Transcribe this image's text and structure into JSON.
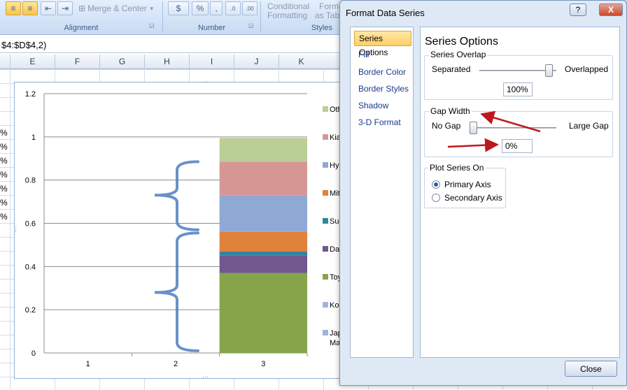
{
  "ribbon": {
    "merge_center": "Merge & Center",
    "currency": "$",
    "percent": "%",
    "comma": ",",
    "inc_decimal": ".0",
    "dec_decimal": ".00",
    "cond_format_1": "Conditional",
    "cond_format_2": "Formatting",
    "format_table_1": "Forma",
    "format_table_2": "as Tabl",
    "groups": {
      "alignment": "Alignment",
      "number": "Number",
      "styles": "Styles"
    }
  },
  "formula": "$4:$D$4,2)",
  "columns": [
    "E",
    "F",
    "G",
    "H",
    "I",
    "J",
    "K"
  ],
  "row_values": [
    "%",
    "%",
    "%",
    "%",
    "%",
    "%",
    "%"
  ],
  "chart_data": {
    "type": "bar",
    "stacked": true,
    "categories": [
      "1",
      "2",
      "3"
    ],
    "series": [
      {
        "name": "Toy",
        "values": [
          0,
          0,
          0.37
        ],
        "color": "#86a44a"
      },
      {
        "name": "Dai",
        "values": [
          0,
          0,
          0.08
        ],
        "color": "#71588f"
      },
      {
        "name": "Suz",
        "values": [
          0,
          0,
          0.02
        ],
        "color": "#31859c"
      },
      {
        "name": "Mit",
        "values": [
          0,
          0,
          0.09
        ],
        "color": "#e0823a"
      },
      {
        "name": "Hy",
        "values": [
          0,
          0,
          0.17
        ],
        "color": "#8fa9d5"
      },
      {
        "name": "Kia",
        "values": [
          0,
          0,
          0.155
        ],
        "color": "#d69794"
      },
      {
        "name": "Oth",
        "values": [
          0,
          0,
          0.11
        ],
        "color": "#b9cf96"
      }
    ],
    "legend_extra": [
      {
        "name": "Kor",
        "color": "#9fb5dc"
      },
      {
        "name": "Jap",
        "name2": "Ma",
        "color": "#9fb5dc"
      }
    ],
    "y_ticks": [
      "0",
      "0.2",
      "0.4",
      "0.6",
      "0.8",
      "1",
      "1.2"
    ],
    "ylim": [
      0,
      1.2
    ],
    "grid": true,
    "legend_position": "right"
  },
  "dialog": {
    "title": "Format Data Series",
    "help": "?",
    "close_x": "X",
    "nav": [
      "Series Options",
      "Fill",
      "Border Color",
      "Border Styles",
      "Shadow",
      "3-D Format"
    ],
    "content_title": "Series Options",
    "overlap": {
      "label": "Series Overlap",
      "left": "Separated",
      "right": "Overlapped",
      "value": "100%",
      "level": 1.0
    },
    "gap": {
      "label": "Gap Width",
      "left": "No Gap",
      "right": "Large Gap",
      "value": "0%",
      "level": 0.0
    },
    "plot_on": {
      "label": "Plot Series On",
      "primary": "Primary Axis",
      "secondary": "Secondary Axis",
      "selected": "primary"
    },
    "close_button": "Close"
  },
  "annotation_color": "#c0161e"
}
